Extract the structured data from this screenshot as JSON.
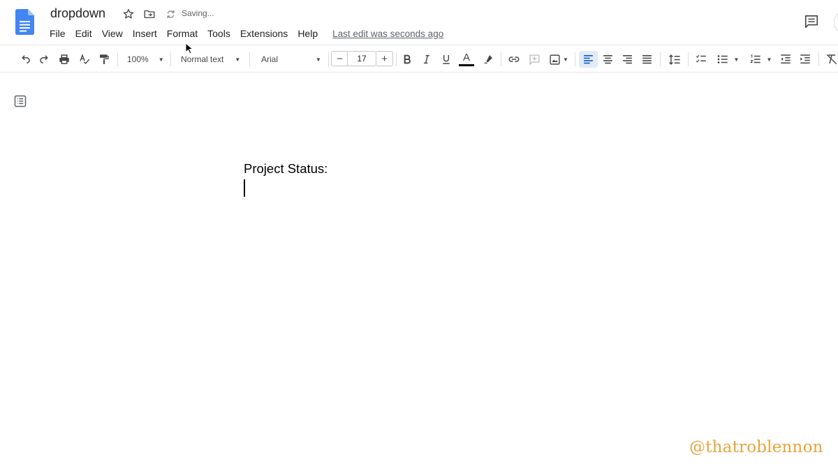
{
  "document": {
    "title": "dropdown",
    "saving_status": "Saving...",
    "last_edit": "Last edit was seconds ago",
    "lines": [
      "Project Status:"
    ]
  },
  "menu": [
    "File",
    "Edit",
    "View",
    "Insert",
    "Format",
    "Tools",
    "Extensions",
    "Help"
  ],
  "toolbar": {
    "zoom": "100%",
    "style": "Normal text",
    "font": "Arial",
    "font_size": "17",
    "minus": "−",
    "plus": "+",
    "text_color_letter": "A"
  },
  "watermark": "@thatroblennon",
  "colors": {
    "docs_blue": "#4285f4",
    "watermark": "#e8a33b",
    "active_highlight": "#e3ebf7"
  },
  "icons": [
    "docs-logo-icon",
    "star-icon",
    "move-folder-icon",
    "sync-icon",
    "comment-icon",
    "undo-icon",
    "redo-icon",
    "print-icon",
    "spellcheck-icon",
    "paint-format-icon",
    "bold-icon",
    "italic-icon",
    "underline-icon",
    "text-color-icon",
    "highlight-icon",
    "link-icon",
    "add-comment-icon",
    "insert-image-icon",
    "align-left-icon",
    "align-center-icon",
    "align-right-icon",
    "justify-icon",
    "line-spacing-icon",
    "checklist-icon",
    "bulleted-list-icon",
    "numbered-list-icon",
    "decrease-indent-icon",
    "increase-indent-icon",
    "clear-formatting-icon",
    "outline-icon"
  ]
}
